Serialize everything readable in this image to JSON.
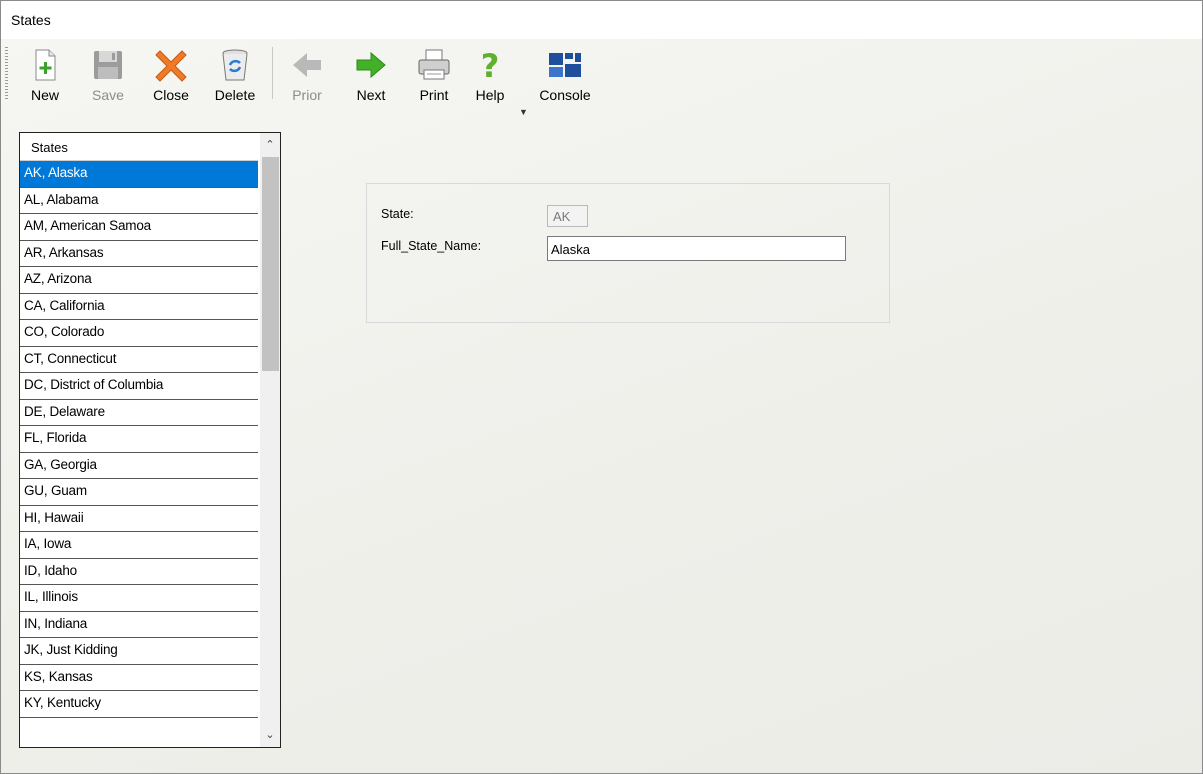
{
  "window": {
    "title": "States"
  },
  "toolbar": {
    "new": "New",
    "save": "Save",
    "close": "Close",
    "delete": "Delete",
    "prior": "Prior",
    "next": "Next",
    "print": "Print",
    "help": "Help",
    "console": "Console"
  },
  "list": {
    "header": "States",
    "selected_index": 0,
    "items": [
      "AK, Alaska",
      "AL, Alabama",
      "AM, American Samoa",
      "AR, Arkansas",
      "AZ, Arizona",
      "CA, California",
      "CO, Colorado",
      "CT, Connecticut",
      "DC, District of Columbia",
      "DE, Delaware",
      "FL, Florida",
      "GA, Georgia",
      "GU, Guam",
      "HI, Hawaii",
      "IA, Iowa",
      "ID, Idaho",
      "IL, Illinois",
      "IN, Indiana",
      "JK, Just Kidding",
      "KS, Kansas",
      "KY, Kentucky"
    ]
  },
  "form": {
    "state_label": "State:",
    "state_value": "AK",
    "full_name_label": "Full_State_Name:",
    "full_name_value": "Alaska"
  },
  "colors": {
    "selection": "#0078d7",
    "accent_green": "#3aa12b"
  }
}
